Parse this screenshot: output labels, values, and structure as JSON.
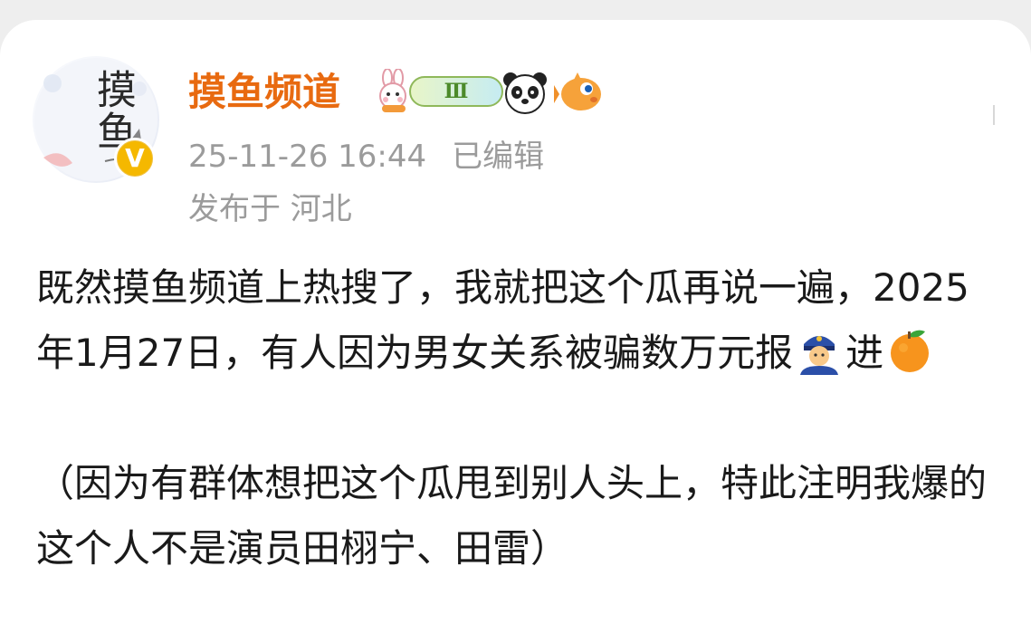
{
  "post": {
    "author": {
      "name": "摸鱼频道",
      "avatar_text": "摸鱼",
      "verified_icon": "v-verified-badge-icon",
      "level_badge": "Ⅲ",
      "badge_icons": [
        "bunny-icon",
        "panda-icon",
        "pufferfish-icon"
      ]
    },
    "timestamp": "25-11-26 16:44",
    "edited_label": "已编辑",
    "location": "发布于 河北",
    "content": {
      "line1": "既然摸鱼频道上热搜了，我就把这个瓜再说一遍，2025年1月27日，有人因为男女关系被骗数万元报",
      "police_emoji": "police-officer-icon",
      "line1_after": "进",
      "orange_emoji": "tangerine-icon",
      "paragraph2": "（因为有群体想把这个瓜甩到别人头上，特此注明我爆的这个人不是演员田栩宁、田雷）"
    }
  },
  "colors": {
    "author_name": "#e86a10",
    "meta_text": "#9b9b9b",
    "body_text": "#1a1a1a",
    "verified_badge": "#f5b800"
  }
}
